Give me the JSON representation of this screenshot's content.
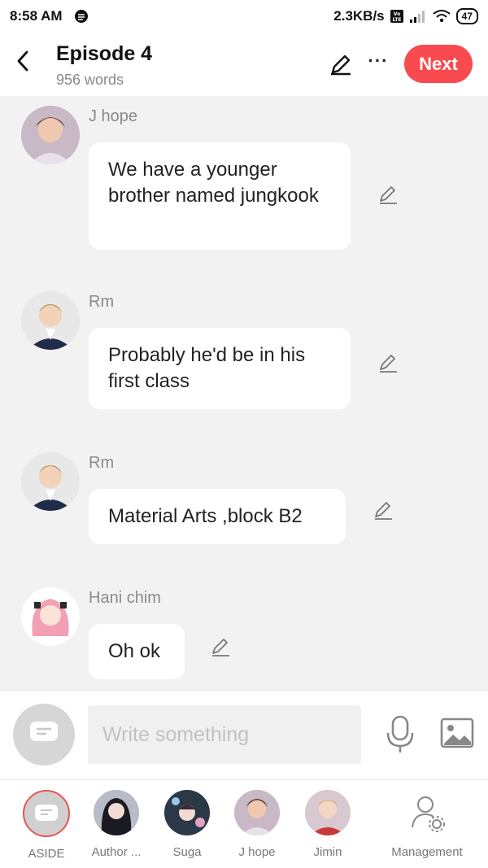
{
  "status_bar": {
    "time": "8:58 AM",
    "network_speed": "2.3KB/s",
    "battery": "47"
  },
  "header": {
    "title": "Episode 4",
    "word_count": "956 words",
    "more_label": "···",
    "next_label": "Next"
  },
  "messages": [
    {
      "speaker": "J hope",
      "text": "We have a younger brother named jungkook"
    },
    {
      "speaker": "Rm",
      "text": "Probably he'd be in his first class"
    },
    {
      "speaker": "Rm",
      "text": "Material Arts ,block B2"
    },
    {
      "speaker": "Hani chim",
      "text": "Oh ok"
    }
  ],
  "composer": {
    "placeholder": "Write something"
  },
  "characters": [
    {
      "label": "ASIDE"
    },
    {
      "label": "Author ..."
    },
    {
      "label": "Suga"
    },
    {
      "label": "J hope"
    },
    {
      "label": "Jimin"
    },
    {
      "label": "Management"
    }
  ],
  "colors": {
    "accent": "#f94a4f",
    "aside_ring": "#e85555"
  },
  "icons": [
    "back-arrow-icon",
    "pencil-icon",
    "more-icon",
    "microphone-icon",
    "image-icon",
    "manage-person-icon",
    "aside-bubble-icon"
  ]
}
